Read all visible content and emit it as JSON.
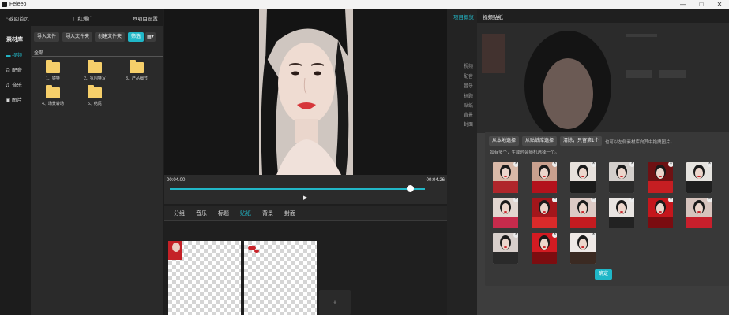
{
  "window": {
    "title": "Feleeo",
    "minimize": "—",
    "maximize": "□",
    "close": "✕"
  },
  "topbar": {
    "back": "返回首页",
    "project_name": "口红爆广",
    "settings": "项目设置"
  },
  "leftnav": {
    "header": "素材库",
    "items": [
      {
        "label": "视频",
        "icon": "video-icon",
        "glyph": "▬",
        "active": true
      },
      {
        "label": "配音",
        "icon": "dub-icon",
        "glyph": "☊",
        "active": false
      },
      {
        "label": "音乐",
        "icon": "music-icon",
        "glyph": "♫",
        "active": false
      },
      {
        "label": "图片",
        "icon": "image-icon",
        "glyph": "▣",
        "active": false
      }
    ]
  },
  "media": {
    "buttons": [
      "导入文件",
      "导入文件夹",
      "创建文件夹"
    ],
    "filter": "筛选",
    "grid_toggle": "▦▾",
    "all": "全部",
    "folders": [
      {
        "label": "1、镜特"
      },
      {
        "label": "2、氛围特写"
      },
      {
        "label": "3、产品细节"
      },
      {
        "label": "4、场景转场"
      },
      {
        "label": "5、结尾"
      }
    ]
  },
  "player": {
    "current": "00:04.00",
    "total": "00:04.26",
    "play_glyph": "▶",
    "progress": 0.94
  },
  "tabs": [
    {
      "label": "分组",
      "active": false
    },
    {
      "label": "音乐",
      "active": false
    },
    {
      "label": "标题",
      "active": false
    },
    {
      "label": "贴纸",
      "active": true
    },
    {
      "label": "背景",
      "active": false
    },
    {
      "label": "封面",
      "active": false
    }
  ],
  "add_glyph": "+",
  "props": {
    "tab": "项目概览",
    "labels": [
      "视频",
      "配音",
      "音乐",
      "标题",
      "贴纸",
      "背景",
      "封面"
    ]
  },
  "dialog": {
    "title": "视频贴纸",
    "buttons": [
      "从本地选择",
      "从贴纸库选择",
      "清除，只留第1个"
    ],
    "hint": "也可以左侧素材库向其中拖拽图片。",
    "hint2": "如有多个，生成时会随机选择一个。",
    "remove_glyph": "×",
    "confirm": "确定",
    "thumbs": [
      {
        "bg": "#d9b9a8",
        "accent": "#b0262b"
      },
      {
        "bg": "#c9a08e",
        "accent": "#b3121c"
      },
      {
        "bg": "#e7e1dc",
        "accent": "#1b1b1b"
      },
      {
        "bg": "#d3cfcc",
        "accent": "#2b2b2b"
      },
      {
        "bg": "#6e1113",
        "accent": "#c51e22"
      },
      {
        "bg": "#e6e3df",
        "accent": "#1f1f1f"
      },
      {
        "bg": "#e2d6d0",
        "accent": "#c72b4c"
      },
      {
        "bg": "#a3161b",
        "accent": "#d92a2a"
      },
      {
        "bg": "#dccac5",
        "accent": "#c41b20"
      },
      {
        "bg": "#e9e5e2",
        "accent": "#222222"
      },
      {
        "bg": "#c5161c",
        "accent": "#7a0c10"
      },
      {
        "bg": "#d6c3bd",
        "accent": "#c81f2c"
      },
      {
        "bg": "#d8cfcb",
        "accent": "#2a2a2a"
      },
      {
        "bg": "#d31b22",
        "accent": "#7c0d10"
      },
      {
        "bg": "#efe9e6",
        "accent": "#3b2a22"
      }
    ]
  },
  "colors": {
    "accent": "#20b7c8",
    "folder": "#f6cf6a"
  }
}
